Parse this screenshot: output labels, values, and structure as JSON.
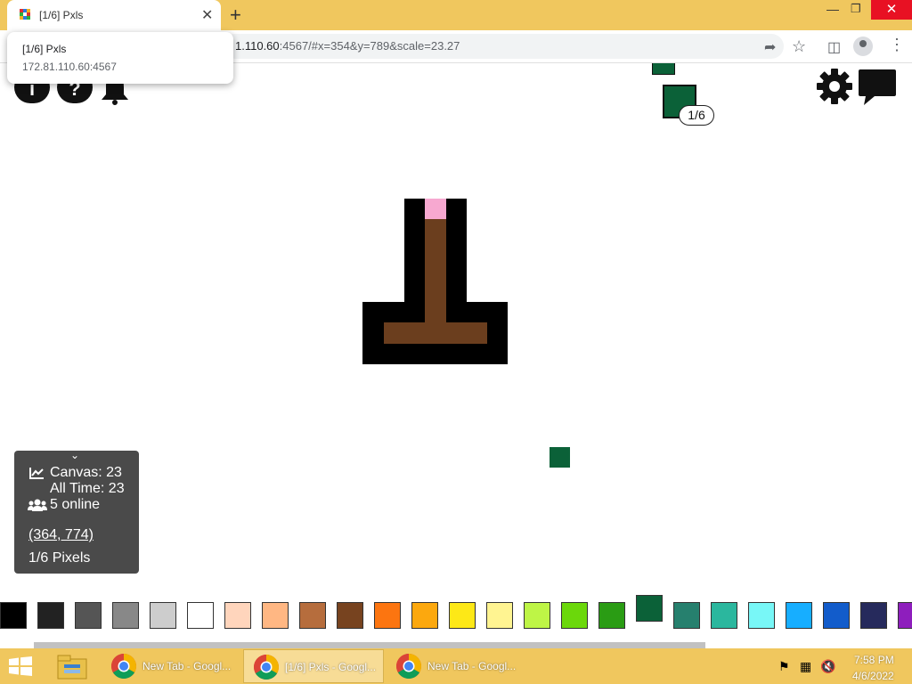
{
  "browser": {
    "tab_title": "[1/6] Pxls",
    "new_tab_symbol": "+",
    "close_symbol": "✕",
    "address_host_fragment": "1.110.60",
    "address_rest": ":4567/#x=354&y=789&scale=23.27",
    "popup_title": "[1/6] Pxls",
    "popup_url": "172.81.110.60:4567"
  },
  "page": {
    "info_button": "i",
    "help_button": "?",
    "stack_badge": "1/6",
    "info_panel": {
      "canvas": "Canvas: 23",
      "all_time": "All Time: 23",
      "online": "5 online",
      "coords": "(364, 774)",
      "pixels": "1/6 Pixels"
    }
  },
  "palette": [
    "#000000",
    "#222222",
    "#555555",
    "#888888",
    "#cdcdcd",
    "#ffffff",
    "#ffd5bc",
    "#ffb783",
    "#b66d3d",
    "#77431f",
    "#fc7510",
    "#fca80e",
    "#fde817",
    "#fff491",
    "#bef546",
    "#6bd80b",
    "#2a9c14",
    "#0b6138",
    "#26806e",
    "#2bb79e",
    "#78f7f7",
    "#17aeff",
    "#125ccb",
    "#262a5c",
    "#8e1ebd"
  ],
  "selected_color": "#0b6138",
  "taskbar": {
    "items": [
      {
        "label": "New Tab - Googl..."
      },
      {
        "label": "[1/6] Pxls - Googl..."
      },
      {
        "label": "New Tab - Googl..."
      }
    ],
    "time": "7:58 PM",
    "date": "4/6/2022"
  },
  "colors": {
    "chrome_accent": "#f0c75e",
    "art_black": "#000000",
    "art_brown": "#6b3e1e",
    "art_pink": "#f7a8d0",
    "stack_green": "#0b6138"
  }
}
